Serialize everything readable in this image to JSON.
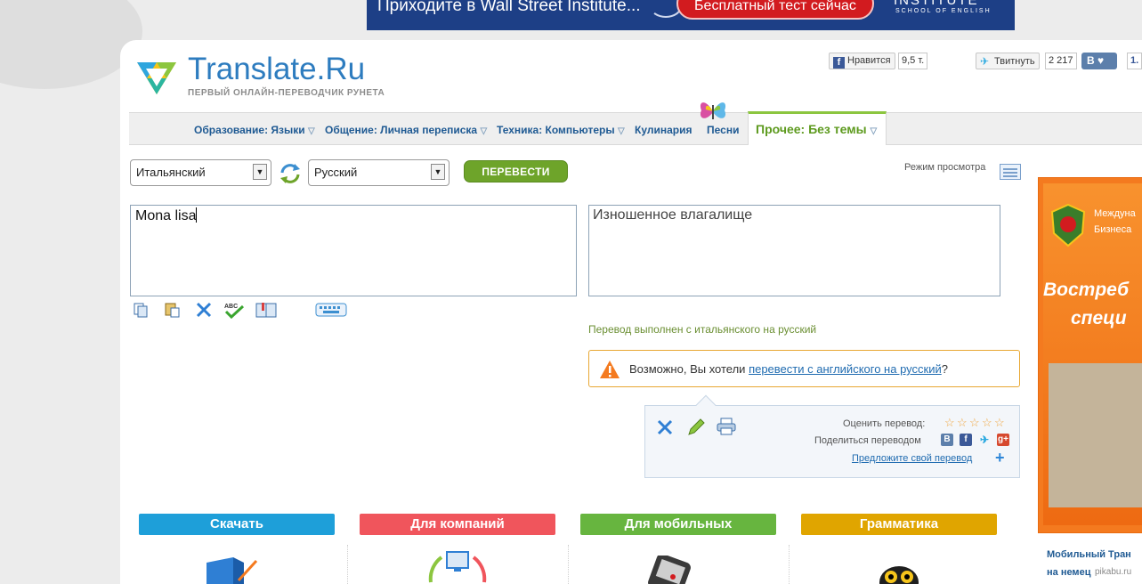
{
  "banner": {
    "text": "Приходите в Wall Street Institute...",
    "button": "Бесплатный тест сейчас",
    "brand": "INSTITUTE",
    "brand_sub": "SCHOOL OF ENGLISH"
  },
  "logo": {
    "title": "Translate.Ru",
    "subtitle": "ПЕРВЫЙ ОНЛАЙН-ПЕРЕВОДЧИК РУНЕТА"
  },
  "social": {
    "fb_label": "Нравится",
    "fb_count": "9,5 т.",
    "tw_label": "Твитнуть",
    "tw_count": "2 217",
    "vk_label": "В",
    "extra_count": "1."
  },
  "nav": {
    "items": [
      "Образование: Языки",
      "Общение: Личная переписка",
      "Техника: Компьютеры",
      "Кулинария",
      "Песни"
    ],
    "active": "Прочее: Без темы"
  },
  "translator": {
    "source_lang": "Итальянский",
    "target_lang": "Русский",
    "translate_button": "ПЕРЕВЕСТИ",
    "view_mode": "Режим просмотра",
    "source_text": "Mona lisa",
    "result_text": "Изношенное влагалище",
    "direction_note": "Перевод выполнен с итальянского на русский",
    "suggest_prefix": "Возможно, Вы хотели ",
    "suggest_link": "перевести с английского на русский",
    "suggest_suffix": "?",
    "rate_label": "Оценить перевод:",
    "share_label": "Поделиться переводом",
    "own_translation": "Предложите свой перевод"
  },
  "tabs": [
    {
      "label": "Скачать",
      "color": "#1e9fd9"
    },
    {
      "label": "Для компаний",
      "color": "#f0555c"
    },
    {
      "label": "Для мобильных",
      "color": "#67b53f"
    },
    {
      "label": "Грамматика",
      "color": "#e0a500"
    }
  ],
  "ad": {
    "line1": "Междуна",
    "line2": "Бизнеса",
    "big1": "Востреб",
    "big2": "специ"
  },
  "promo": {
    "line1": "Мобильный Тран",
    "line2": "на немец"
  },
  "watermark": "pikabu.ru"
}
